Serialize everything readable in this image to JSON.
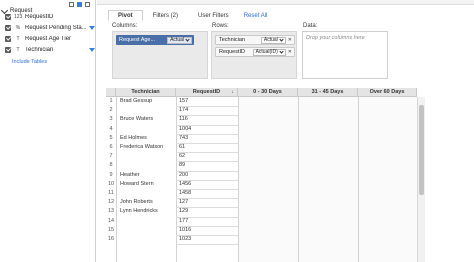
{
  "field_list": {
    "group_label": "Request",
    "fields": [
      {
        "type_icon": "123",
        "name": "RequestID",
        "checked": true,
        "filter": false
      },
      {
        "type_icon": "%",
        "name": "Request Pending Sta...",
        "checked": true,
        "filter": true
      },
      {
        "type_icon": "T",
        "name": "Request Age Tier",
        "checked": true,
        "filter": false
      },
      {
        "type_icon": "T",
        "name": "Technician",
        "checked": true,
        "filter": true
      }
    ],
    "include_link": "Include Tables"
  },
  "tabs": [
    {
      "label": "Pivot",
      "active": true
    },
    {
      "label": "Filters (2)",
      "active": false
    },
    {
      "label": "User Filters",
      "active": false
    },
    {
      "label": "Reset All",
      "active": false,
      "link": true
    }
  ],
  "config": {
    "columns_label": "Columns:",
    "rows_label": "Rows:",
    "data_label": "Data:",
    "data_placeholder": "Drop your columns here",
    "column_pills": [
      {
        "name": "Request Age...",
        "select": "Actual"
      }
    ],
    "row_pills": [
      {
        "name": "Technician",
        "select": "Actual"
      },
      {
        "name": "RequestID",
        "select": "Actual(ID)"
      }
    ]
  },
  "grid": {
    "headers": [
      "Technician",
      "RequestID",
      "0 - 30 Days",
      "31 - 45 Days",
      "Over 60 Days"
    ],
    "rows": [
      {
        "n": "1",
        "tech": "Brad Gessup",
        "id": "157"
      },
      {
        "n": "2",
        "tech": "",
        "id": "174"
      },
      {
        "n": "3",
        "tech": "Bruce Waters",
        "id": "116"
      },
      {
        "n": "4",
        "tech": "",
        "id": "1004"
      },
      {
        "n": "5",
        "tech": "Ed Holmes",
        "id": "743"
      },
      {
        "n": "6",
        "tech": "Frederica Watson",
        "id": "61"
      },
      {
        "n": "7",
        "tech": "",
        "id": "62"
      },
      {
        "n": "8",
        "tech": "",
        "id": "89"
      },
      {
        "n": "9",
        "tech": "Heather",
        "id": "200"
      },
      {
        "n": "10",
        "tech": "Howard Stern",
        "id": "1456"
      },
      {
        "n": "11",
        "tech": "",
        "id": "1458"
      },
      {
        "n": "12",
        "tech": "John Roberts",
        "id": "127"
      },
      {
        "n": "13",
        "tech": "Lynn Hendricks",
        "id": "129"
      },
      {
        "n": "14",
        "tech": "",
        "id": "177"
      },
      {
        "n": "15",
        "tech": "",
        "id": "1016"
      },
      {
        "n": "16",
        "tech": "",
        "id": "1023"
      }
    ]
  }
}
